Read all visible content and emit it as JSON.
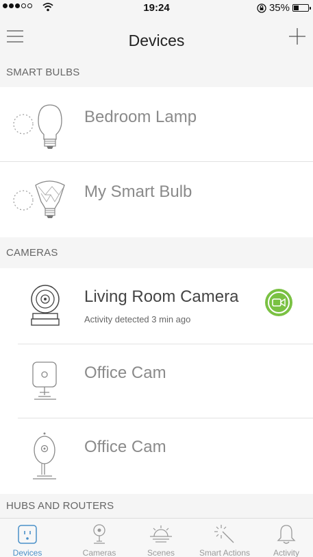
{
  "status_bar": {
    "time": "19:24",
    "battery_label": "35%",
    "battery_level": 0.35,
    "signal_bars": 3
  },
  "nav": {
    "title": "Devices"
  },
  "sections": {
    "smart_bulbs": "SMART BULBS",
    "cameras": "CAMERAS",
    "hubs": "HUBS AND ROUTERS"
  },
  "devices": {
    "bedroom_lamp": {
      "name": "Bedroom Lamp"
    },
    "my_smart_bulb": {
      "name": "My Smart Bulb"
    },
    "living_room_camera": {
      "name": "Living Room Camera",
      "status": "Activity detected 3 min ago"
    },
    "office_cam_1": {
      "name": "Office Cam"
    },
    "office_cam_2": {
      "name": "Office Cam"
    }
  },
  "tabs": [
    {
      "label": "Devices",
      "icon": "outlet-icon",
      "active": true
    },
    {
      "label": "Cameras",
      "icon": "camera-icon",
      "active": false
    },
    {
      "label": "Scenes",
      "icon": "sunrise-icon",
      "active": false
    },
    {
      "label": "Smart Actions",
      "icon": "magic-wand-icon",
      "active": false
    },
    {
      "label": "Activity",
      "icon": "bell-icon",
      "active": false
    }
  ],
  "colors": {
    "accent_blue": "#4a90c8",
    "camera_live_green": "#7ac143",
    "header_gray": "#f5f5f5"
  }
}
